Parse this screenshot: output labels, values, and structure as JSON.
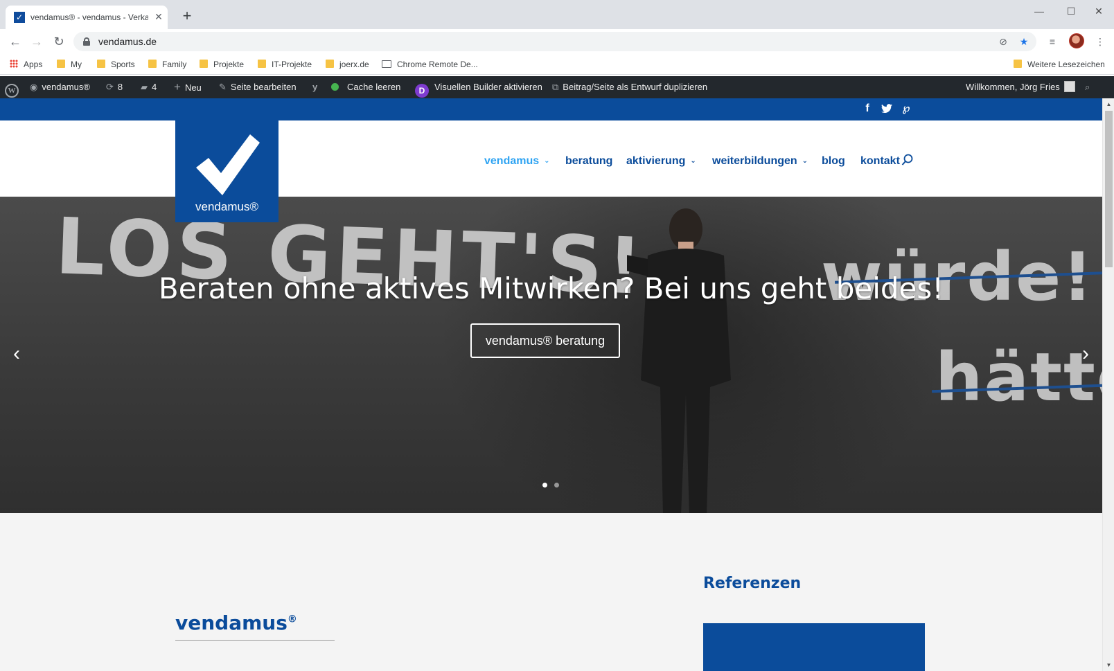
{
  "browser": {
    "tab_title": "vendamus® - vendamus - Verkaufsberatung",
    "url": "vendamus.de",
    "new_tab_symbol": "+",
    "close_symbol": "✕"
  },
  "bookmarks": {
    "items": [
      {
        "label": "Apps",
        "icon": "apps-icon"
      },
      {
        "label": "My",
        "icon": "folder-icon"
      },
      {
        "label": "Sports",
        "icon": "folder-icon"
      },
      {
        "label": "Family",
        "icon": "folder-icon"
      },
      {
        "label": "Projekte",
        "icon": "folder-icon"
      },
      {
        "label": "IT-Projekte",
        "icon": "folder-icon"
      },
      {
        "label": "joerx.de",
        "icon": "folder-icon"
      },
      {
        "label": "Chrome Remote De...",
        "icon": "remote-desktop-icon"
      }
    ],
    "other": "Weitere Lesezeichen"
  },
  "adminbar": {
    "site_name": "vendamus®",
    "updates_count": "8",
    "comments_count": "4",
    "new_label": "Neu",
    "edit_label": "Seite bearbeiten",
    "cache_label": "Cache leeren",
    "builder_label": "Visuellen Builder aktivieren",
    "duplicate_label": "Beitrag/Seite als Entwurf duplizieren",
    "welcome": "Willkommen, Jörg Fries",
    "divi_letter": "D",
    "yoast_letter": "y"
  },
  "site": {
    "logo_text": "vendamus®",
    "nav": [
      {
        "label": "vendamus",
        "dropdown": true,
        "active": true
      },
      {
        "label": "beratung",
        "dropdown": false,
        "active": false
      },
      {
        "label": "aktivierung",
        "dropdown": true,
        "active": false
      },
      {
        "label": "weiterbildungen",
        "dropdown": true,
        "active": false
      },
      {
        "label": "blog",
        "dropdown": false,
        "active": false
      },
      {
        "label": "kontakt",
        "dropdown": false,
        "active": false
      }
    ],
    "social": [
      "f",
      "twitter",
      "pinterest"
    ]
  },
  "hero": {
    "heading": "Beraten ohne aktives Mitwirken? Bei uns geht beides!",
    "button": "vendamus® beratung",
    "chalk_main": "LOS GEHT'S!",
    "chalk_w": "würde!",
    "chalk_h": "hätte",
    "slides": 2,
    "active_slide": 1
  },
  "content": {
    "title": "vendamus",
    "title_mark": "®",
    "sidebar_title": "Referenzen"
  },
  "colors": {
    "brand": "#0b4c9b",
    "nav_active": "#2ea3f2",
    "adminbar": "#23282d"
  }
}
